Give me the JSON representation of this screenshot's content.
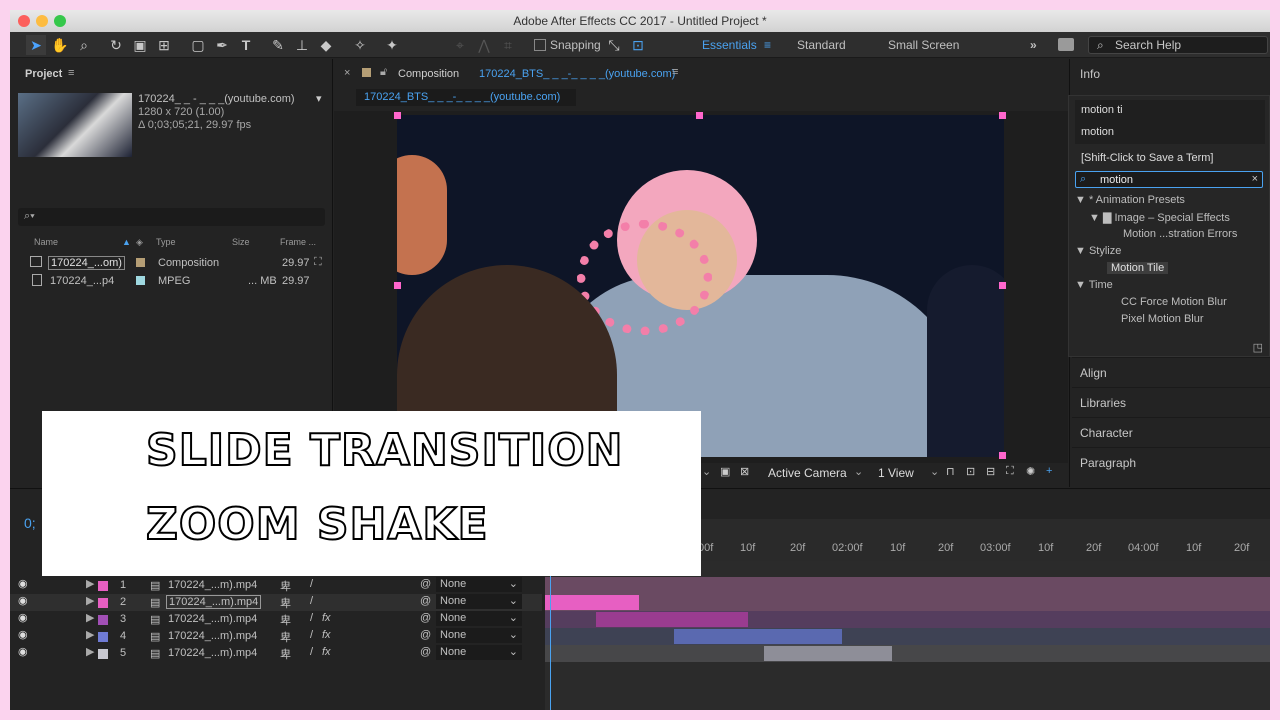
{
  "window": {
    "title": "Adobe After Effects CC 2017 - Untitled Project *"
  },
  "toolbar": {
    "snapping": "Snapping",
    "workspaces": [
      "Essentials",
      "Standard",
      "Small Screen"
    ],
    "search_help": "Search Help"
  },
  "project": {
    "title": "Project",
    "item_name": "170224_ _ - _ _ _(youtube.com)",
    "item_size": "1280 x 720 (1.00)",
    "item_duration": "Δ 0;03;05;21, 29.97 fps",
    "columns": [
      "Name",
      "Type",
      "Size",
      "Frame ..."
    ],
    "rows": [
      {
        "name": "170224_...om)",
        "type": "Composition",
        "size": "",
        "fps": "29.97"
      },
      {
        "name": "170224_...p4",
        "type": "MPEG",
        "size": "... MB",
        "fps": "29.97"
      }
    ]
  },
  "composition": {
    "title_prefix": "Composition",
    "title_name": "170224_BTS_ _ _-_ _ _ _(youtube.com)",
    "tab": "170224_BTS_ _ _-_ _ _ _(youtube.com)",
    "camera": "Active Camera",
    "view": "1 View"
  },
  "right_panel": {
    "info": "Info",
    "history": [
      "motion ti",
      "motion"
    ],
    "save_hint": "[Shift-Click to Save a Term]",
    "search_value": "motion",
    "tree": [
      "▼ * Animation Presets",
      "▼ ▇ Image – Special Effects",
      "Motion ...stration Errors",
      "▼ Stylize",
      "Motion Tile",
      "▼ Time",
      "CC Force Motion Blur",
      "Pixel Motion Blur"
    ],
    "panels": [
      "Align",
      "Libraries",
      "Character",
      "Paragraph"
    ]
  },
  "timeline": {
    "time": "0;",
    "ruler": [
      "00f",
      "10f",
      "20f",
      "02:00f",
      "10f",
      "20f",
      "03:00f",
      "10f",
      "20f",
      "04:00f",
      "10f",
      "20f"
    ],
    "layers": [
      {
        "num": "1",
        "name": "170224_...m).mp4",
        "mode": "None",
        "fx": "",
        "color": "#e75fc2"
      },
      {
        "num": "2",
        "name": "170224_...m).mp4",
        "mode": "None",
        "fx": "",
        "color": "#e75fc2"
      },
      {
        "num": "3",
        "name": "170224_...m).mp4",
        "mode": "None",
        "fx": "fx",
        "color": "#a14fb5"
      },
      {
        "num": "4",
        "name": "170224_...m).mp4",
        "mode": "None",
        "fx": "fx",
        "color": "#6f7bd4"
      },
      {
        "num": "5",
        "name": "170224_...m).mp4",
        "mode": "None",
        "fx": "fx",
        "color": "#c7c7cf"
      }
    ]
  },
  "overlay": {
    "line1": "SLIDE TRANSITION",
    "line2": "ZOOM SHAKE"
  },
  "colors": {
    "accent": "#4aa2f0",
    "handle": "#ff66cc",
    "background": "#fbd3ee"
  }
}
